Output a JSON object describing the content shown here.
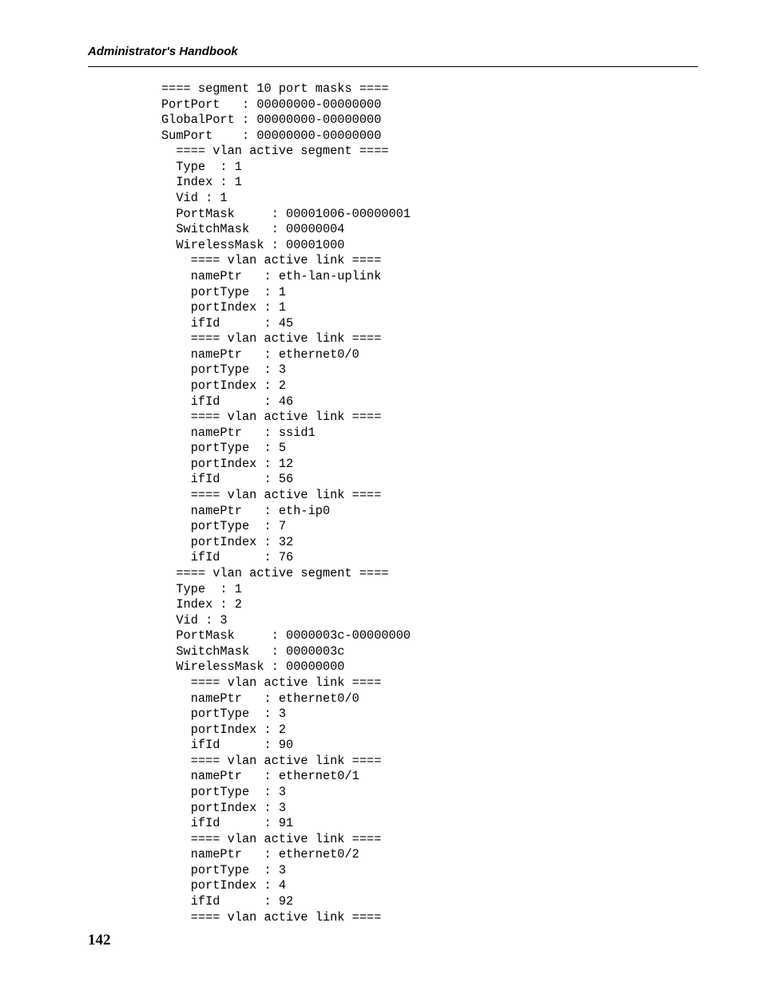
{
  "header": {
    "title": "Administrator's Handbook"
  },
  "code": {
    "lines": [
      "==== segment 10 port masks ====",
      "PortPort   : 00000000-00000000",
      "GlobalPort : 00000000-00000000",
      "SumPort    : 00000000-00000000",
      "  ==== vlan active segment ====",
      "  Type  : 1",
      "  Index : 1",
      "  Vid : 1",
      "  PortMask     : 00001006-00000001",
      "  SwitchMask   : 00000004",
      "  WirelessMask : 00001000",
      "    ==== vlan active link ====",
      "    namePtr   : eth-lan-uplink",
      "    portType  : 1",
      "    portIndex : 1",
      "    ifId      : 45",
      "    ==== vlan active link ====",
      "    namePtr   : ethernet0/0",
      "    portType  : 3",
      "    portIndex : 2",
      "    ifId      : 46",
      "    ==== vlan active link ====",
      "    namePtr   : ssid1",
      "    portType  : 5",
      "    portIndex : 12",
      "    ifId      : 56",
      "    ==== vlan active link ====",
      "    namePtr   : eth-ip0",
      "    portType  : 7",
      "    portIndex : 32",
      "    ifId      : 76",
      "  ==== vlan active segment ====",
      "  Type  : 1",
      "  Index : 2",
      "  Vid : 3",
      "  PortMask     : 0000003c-00000000",
      "  SwitchMask   : 0000003c",
      "  WirelessMask : 00000000",
      "    ==== vlan active link ====",
      "    namePtr   : ethernet0/0",
      "    portType  : 3",
      "    portIndex : 2",
      "    ifId      : 90",
      "    ==== vlan active link ====",
      "    namePtr   : ethernet0/1",
      "    portType  : 3",
      "    portIndex : 3",
      "    ifId      : 91",
      "    ==== vlan active link ====",
      "    namePtr   : ethernet0/2",
      "    portType  : 3",
      "    portIndex : 4",
      "    ifId      : 92",
      "    ==== vlan active link ===="
    ]
  },
  "footer": {
    "page_number": "142"
  }
}
